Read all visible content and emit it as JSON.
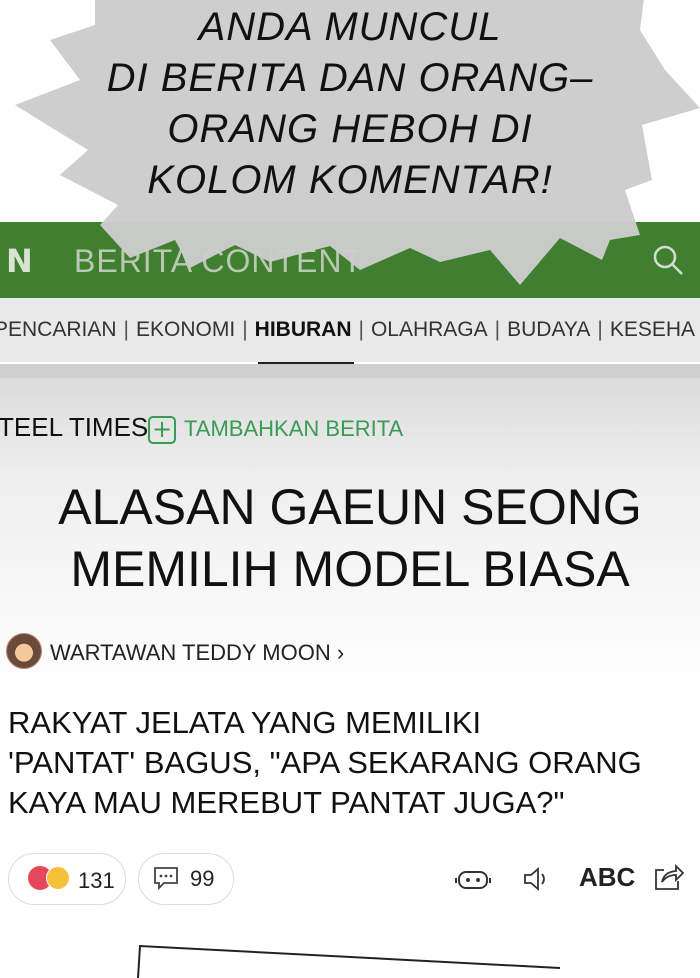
{
  "speech_bubble": {
    "line1": "ANDA MUNCUL",
    "line2": "DI BERITA DAN ORANG–",
    "line3": "ORANG HEBOH DI",
    "line4": "KOLOM KOMENTAR!"
  },
  "app_header": {
    "logo": "N",
    "title": "BERITA CONTENT",
    "search_icon": "search-icon"
  },
  "category_nav": {
    "items": [
      "PENCARIAN",
      "EKONOMI",
      "HIBURAN",
      "OLAHRAGA",
      "BUDAYA",
      "KESEHA"
    ],
    "active": "HIBURAN"
  },
  "article": {
    "publisher": "TEEL TIMES",
    "add_news_label": "TAMBAHKAN BERITA",
    "headline_line1": "ALASAN GAEUN SEONG",
    "headline_line2": "MEMILIH MODEL BIASA",
    "reporter": "WARTAWAN TEDDY MOON",
    "subhead_line1": "RAKYAT JELATA YANG MEMILIKI",
    "subhead_line2": "'PANTAT' BAGUS, \"APA SEKARANG ORANG",
    "subhead_line3": "KAYA MAU MEREBUT PANTAT JUGA?\""
  },
  "actions": {
    "reaction_count": "131",
    "comment_count": "99",
    "abc_label": "ABC"
  },
  "colors": {
    "header_green": "#3f7f2f",
    "accent_green": "#3a9b55",
    "bubble_grey": "#cccccc"
  }
}
